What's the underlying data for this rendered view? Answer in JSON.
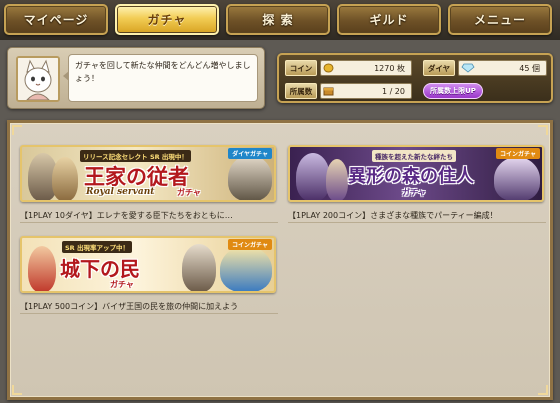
{
  "nav": {
    "tabs": [
      {
        "label": "マイページ"
      },
      {
        "label": "ガチャ",
        "active": true
      },
      {
        "label": "探 索"
      },
      {
        "label": "ギルド"
      },
      {
        "label": "メニュー"
      }
    ]
  },
  "message": {
    "text": "ガチャを回して新たな仲間をどんどん増やしましょう！"
  },
  "status": {
    "coin_label": "コイン",
    "coin_value": "1270 枚",
    "diamond_label": "ダイヤ",
    "diamond_value": "45 個",
    "roster_label": "所属数",
    "roster_value": "1 / 20",
    "roster_up_label": "所属数上限UP"
  },
  "gachas": [
    {
      "banner_sub": "リリース記念セレクト SR 出現中！",
      "banner_title": "王家の従者",
      "banner_title_en": "Royal servant",
      "banner_kana": "ガチャ",
      "currency_tag": "ダイヤガチャ",
      "description": "【1PLAY 10ダイヤ】エレナを愛する臣下たちをおともに…",
      "accent": "#c0392b"
    },
    {
      "banner_sub": "種族を超えた新たな絆たち",
      "banner_title": "異形の森の住人",
      "banner_kana": "ガチャ",
      "currency_tag": "コインガチャ",
      "description": "【1PLAY 200コイン】さまざまな種族でパーティー編成！",
      "accent": "#7b3fa8"
    },
    {
      "banner_sub": "SR 出現率アップ中！",
      "banner_title": "城下の民",
      "banner_kana": "ガチャ",
      "currency_tag": "コインガチャ",
      "description": "【1PLAY 500コイン】バイザ王国の民を旅の仲間に加えよう",
      "accent": "#c0392b"
    }
  ],
  "colors": {
    "gold_border": "#c6a253",
    "active_tab": "#f2cd55",
    "panel_bg": "#d9d0c0"
  }
}
